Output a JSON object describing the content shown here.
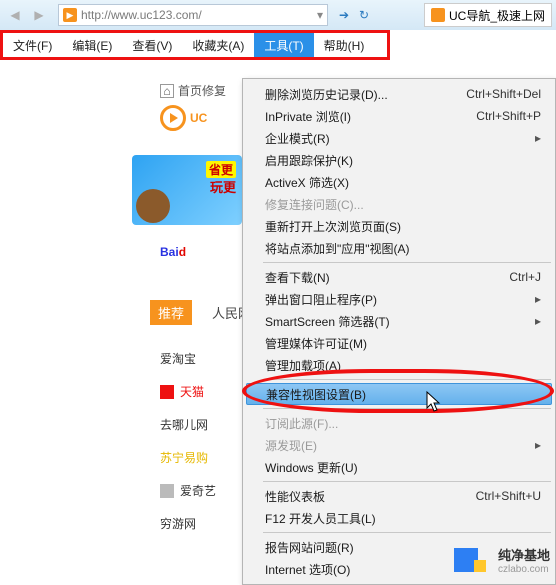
{
  "titlebar": {
    "url": "http://www.uc123.com/",
    "tab_label": "UC导航_极速上网"
  },
  "menubar": {
    "file": "文件(F)",
    "edit": "编辑(E)",
    "view": "查看(V)",
    "fav": "收藏夹(A)",
    "tools": "工具(T)",
    "help": "帮助(H)"
  },
  "breadcrumb": {
    "home_icon": "⌂",
    "home_text": "首页修复"
  },
  "page": {
    "logo_text": "UC",
    "promo_line1": "省更",
    "promo_line2": "玩更",
    "baidu_b": "Bai",
    "baidu_d": "d",
    "tab_hot": "推荐",
    "tab_rm": "人民网",
    "links": {
      "aitaobao": "爱淘宝",
      "tmall": "天猫",
      "qunar": "去哪儿网",
      "suning": "苏宁易购",
      "iqiyi": "爱奇艺",
      "qyer": "穷游网"
    }
  },
  "tools_menu": {
    "delete_history": "删除浏览历史记录(D)...",
    "delete_history_sc": "Ctrl+Shift+Del",
    "inprivate": "InPrivate 浏览(I)",
    "inprivate_sc": "Ctrl+Shift+P",
    "enterprise": "企业模式(R)",
    "tracking": "启用跟踪保护(K)",
    "activex": "ActiveX 筛选(X)",
    "fix_conn": "修复连接问题(C)...",
    "reopen": "重新打开上次浏览页面(S)",
    "add_to_apps": "将站点添加到\"应用\"视图(A)",
    "downloads": "查看下载(N)",
    "downloads_sc": "Ctrl+J",
    "popup": "弹出窗口阻止程序(P)",
    "smartscreen": "SmartScreen 筛选器(T)",
    "media": "管理媒体许可证(M)",
    "addons": "管理加载项(A)",
    "compat": "兼容性视图设置(B)",
    "feeds": "订阅此源(F)...",
    "feed_discovery": "源发现(E)",
    "win_update": "Windows 更新(U)",
    "perf": "性能仪表板",
    "perf_sc": "Ctrl+Shift+U",
    "f12": "F12 开发人员工具(L)",
    "report": "报告网站问题(R)",
    "options": "Internet 选项(O)"
  },
  "watermark": {
    "name": "纯净基地",
    "url": "czlabo.com"
  }
}
